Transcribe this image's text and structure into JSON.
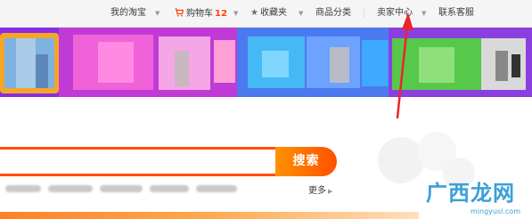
{
  "topnav": {
    "my_taobao": "我的淘宝",
    "cart_label": "购物车",
    "cart_count": "12",
    "favorites": "收藏夹",
    "categories": "商品分类",
    "seller_center": "卖家中心",
    "contact_service": "联系客服"
  },
  "search": {
    "value": "",
    "button_label": "搜索"
  },
  "more": {
    "label": "更多"
  },
  "watermark": {
    "text": "广西龙网",
    "url": "mingyusl.com"
  },
  "colors": {
    "accent": "#ff5000",
    "arrow": "#e8262b",
    "watermark": "#3aa0d8"
  },
  "icons": {
    "cart": "cart-icon",
    "favorites": "star-icon",
    "caret": "caret-down-icon"
  }
}
